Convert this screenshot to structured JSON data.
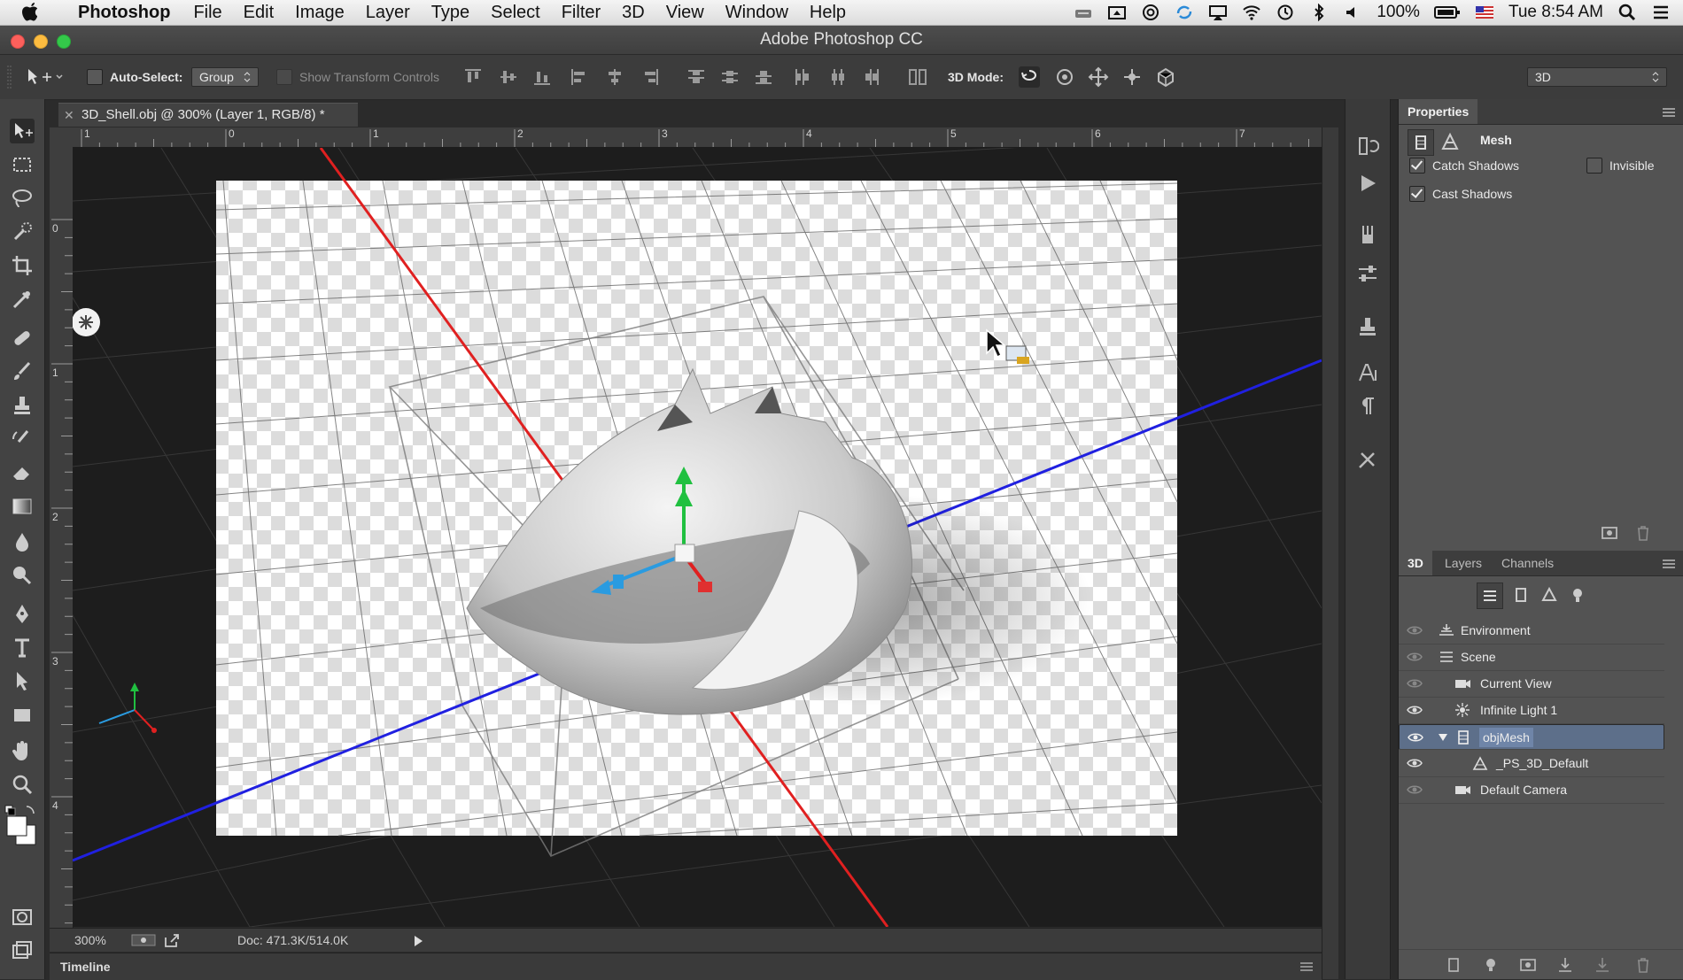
{
  "menubar": {
    "app": "Photoshop",
    "items": [
      "File",
      "Edit",
      "Image",
      "Layer",
      "Type",
      "Select",
      "Filter",
      "3D",
      "View",
      "Window",
      "Help"
    ],
    "battery": "100%",
    "clock": "Tue 8:54 AM"
  },
  "window": {
    "title": "Adobe Photoshop CC"
  },
  "options": {
    "auto_select_label": "Auto-Select:",
    "auto_select_value": "Group",
    "show_transform_label": "Show Transform Controls",
    "mode_label": "3D Mode:",
    "workspace": "3D"
  },
  "document": {
    "tab": "3D_Shell.obj @ 300% (Layer 1, RGB/8) *",
    "zoom": "300%",
    "doc_size": "Doc: 471.3K/514.0K",
    "ruler_top": [
      "1",
      "0",
      "1",
      "2",
      "3",
      "4",
      "5",
      "6",
      "7"
    ],
    "ruler_left": [
      "0",
      "1",
      "2",
      "3",
      "4"
    ]
  },
  "timeline": {
    "label": "Timeline"
  },
  "properties": {
    "title": "Properties",
    "section": "Mesh",
    "catch_shadows": "Catch Shadows",
    "invisible": "Invisible",
    "cast_shadows": "Cast Shadows"
  },
  "panel3d": {
    "tabs": [
      "3D",
      "Layers",
      "Channels"
    ],
    "rows": [
      {
        "name": "Environment",
        "icon": "environment-icon"
      },
      {
        "name": "Scene",
        "icon": "scene-icon"
      },
      {
        "name": "Current View",
        "icon": "camera-icon"
      },
      {
        "name": "Infinite Light 1",
        "icon": "light-icon"
      },
      {
        "name": "objMesh",
        "icon": "mesh-icon"
      },
      {
        "name": "_PS_3D_Default",
        "icon": "material-icon"
      },
      {
        "name": "Default Camera",
        "icon": "camera-icon"
      }
    ]
  },
  "colors": {
    "selection": "#5d6f8a",
    "panel": "#535353",
    "x_axis": "#e02020",
    "z_axis": "#2020e0",
    "y_axis": "#20c040"
  }
}
